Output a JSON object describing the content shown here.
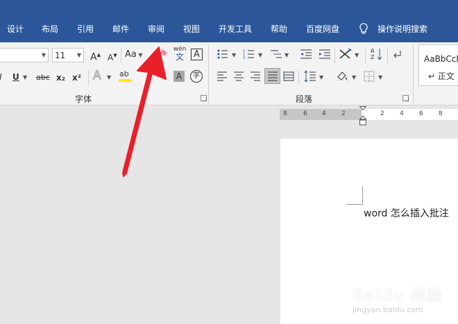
{
  "tabs": [
    {
      "label": "设计",
      "name": "tab-design"
    },
    {
      "label": "布局",
      "name": "tab-layout"
    },
    {
      "label": "引用",
      "name": "tab-references"
    },
    {
      "label": "邮件",
      "name": "tab-mailings"
    },
    {
      "label": "审阅",
      "name": "tab-review"
    },
    {
      "label": "视图",
      "name": "tab-view"
    },
    {
      "label": "开发工具",
      "name": "tab-developer"
    },
    {
      "label": "帮助",
      "name": "tab-help"
    },
    {
      "label": "百度网盘",
      "name": "tab-baidu-netdisk"
    }
  ],
  "tell_me": {
    "label": "操作说明搜索",
    "icon": "lightbulb-icon"
  },
  "font": {
    "font_size": "11",
    "change_case": "Aa",
    "group_label": "字体",
    "phonetic_top": "wén",
    "phonetic_bottom": "文",
    "char_border": "A",
    "underline": "U",
    "strike": "abc",
    "subscript": "x₂",
    "superscript": "x²",
    "text_effects": "A",
    "highlight": "ab",
    "shading": "A",
    "enclose": "字",
    "grow": "A",
    "shrink": "A"
  },
  "paragraph": {
    "group_label": "段落"
  },
  "styles": {
    "sample": "AaBbCcD",
    "normal_label": "↵ 正文"
  },
  "ruler": {
    "ticks": [
      "8",
      "6",
      "4",
      "2",
      "2",
      "4",
      "6",
      "8"
    ]
  },
  "document": {
    "text": "word 怎么插入批注"
  },
  "watermark": {
    "brand": "Baidu 经验",
    "url": "jingyan.baidu.com"
  },
  "colors": {
    "ribbon_tab": "#2b579a",
    "annotation_arrow": "#e8202a",
    "highlight_yellow": "#ffe600"
  }
}
